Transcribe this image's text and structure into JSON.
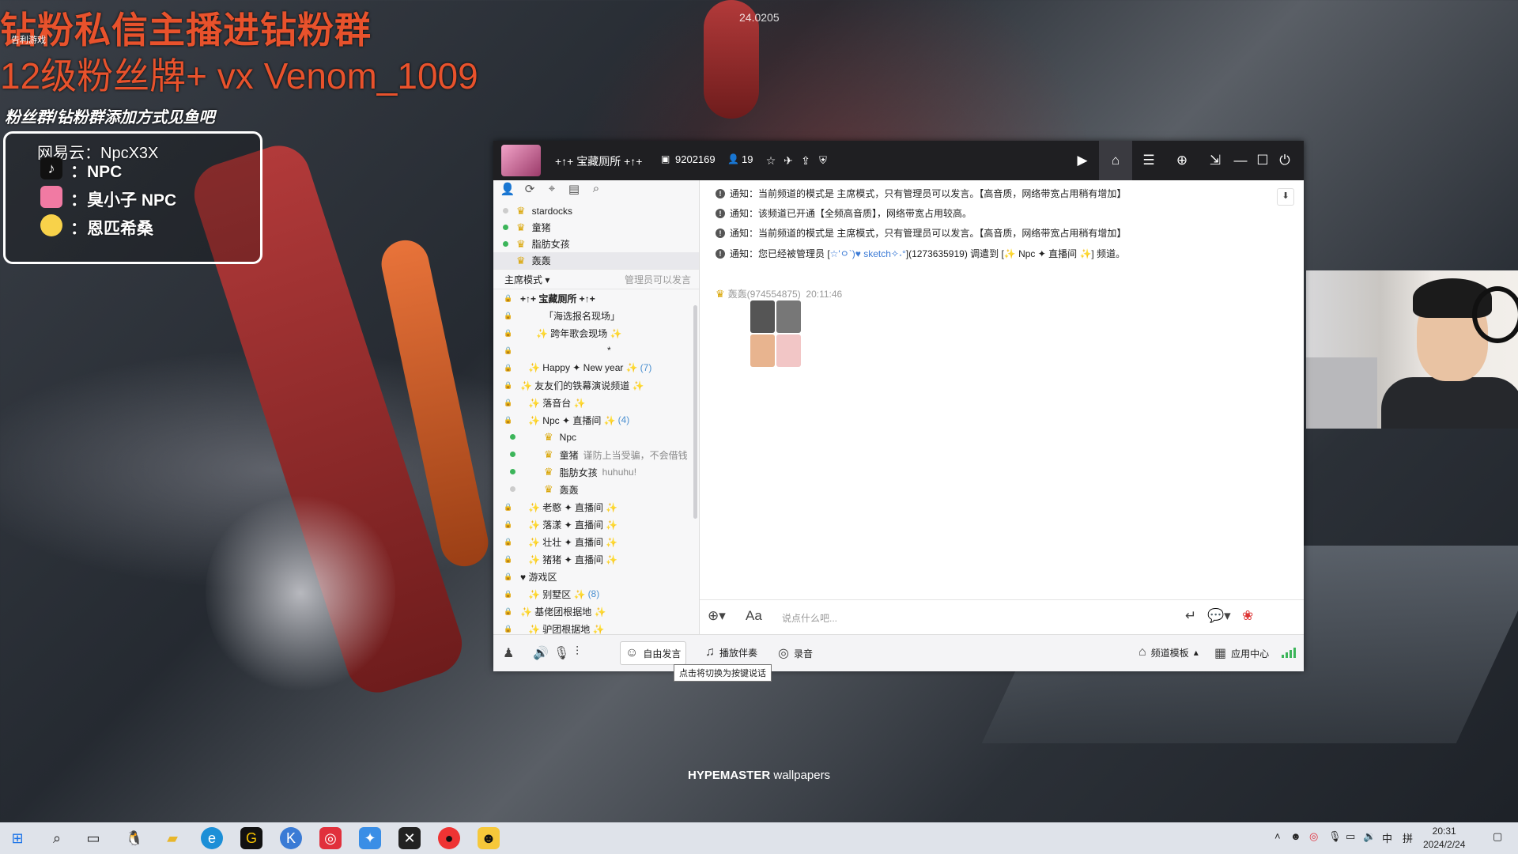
{
  "overlay": {
    "line1": "钻粉私信主播进钻粉群",
    "small": "告利游戏",
    "line2": "12级粉丝牌+ vx Venom_1009",
    "line3": "粉丝群/钻粉群添加方式见鱼吧",
    "netease": "网易云：NpcX3X",
    "tiktok": "：NPC",
    "bilibili": "：臭小子 NPC",
    "weibo": "：恩匹希桑",
    "center_num": "24.0205",
    "hype_bold": "HYPEMASTER",
    "hype_rest": " wallpapers"
  },
  "app": {
    "title_prefix": "+↑+ 宝藏厕所 +↑+",
    "room_id": "9202169",
    "online": "19",
    "members": [
      {
        "name": "stardocks",
        "status": "off"
      },
      {
        "name": "童猪",
        "status": "on"
      },
      {
        "name": "脂肪女孩",
        "status": "on"
      },
      {
        "name": "轰轰",
        "status": "sel"
      }
    ],
    "mode_label": "主席模式",
    "mode_note": "管理员可以发言",
    "channels": [
      {
        "text": "+↑+ 宝藏厕所 +↑+",
        "count": "",
        "indent": 0,
        "bold": true
      },
      {
        "text": "「海选报名现场」",
        "count": "",
        "indent": 30
      },
      {
        "text": "✨ 跨年歌会现场 ✨",
        "count": "",
        "indent": 20
      },
      {
        "text": "*",
        "count": "",
        "indent": 110
      },
      {
        "text": "✨ Happy ✦ New year ✨",
        "count": "(7)",
        "indent": 10
      },
      {
        "text": "✨ 友友们的铁幕演说频道 ✨",
        "count": "",
        "indent": 0
      },
      {
        "text": "✨   落音台   ✨",
        "count": "",
        "indent": 10
      },
      {
        "text": "✨  Npc ✦ 直播间  ✨",
        "count": "(4)",
        "indent": 10,
        "active": true
      },
      {
        "text": "Npc",
        "count": "",
        "indent": 30,
        "user": true,
        "note": ""
      },
      {
        "text": "童猪",
        "count": "",
        "indent": 30,
        "user": true,
        "note": "谨防上当受骗，不会借钱"
      },
      {
        "text": "脂肪女孩",
        "count": "",
        "indent": 30,
        "user": true,
        "note": "huhuhu!"
      },
      {
        "text": "轰轰",
        "count": "",
        "indent": 30,
        "user": true,
        "note": ""
      },
      {
        "text": "✨  老憨 ✦ 直播间  ✨",
        "count": "",
        "indent": 10
      },
      {
        "text": "✨  落漾 ✦ 直播间  ✨",
        "count": "",
        "indent": 10
      },
      {
        "text": "✨  壮壮 ✦ 直播间  ✨",
        "count": "",
        "indent": 10
      },
      {
        "text": "✨  猪猪 ✦ 直播间  ✨",
        "count": "",
        "indent": 10
      },
      {
        "text": "♥   游戏区",
        "count": "",
        "indent": 0
      },
      {
        "text": "✨    别墅区    ✨",
        "count": "(8)",
        "indent": 10
      },
      {
        "text": "✨ 基佬团根据地 ✨",
        "count": "",
        "indent": 0
      },
      {
        "text": "✨ 驴团根据地 ✨",
        "count": "",
        "indent": 10
      }
    ],
    "notices": [
      "通知：当前频道的模式是 主席模式，只有管理员可以发言。【高音质，网络带宽占用稍有增加】",
      "通知：该频道已开通【全频高音质】，网络带宽占用较高。",
      "通知：当前频道的模式是 主席模式，只有管理员可以发言。【高音质，网络带宽占用稍有增加】"
    ],
    "notice4_a": "通知：您已经被管理员 [",
    "notice4_b": "☆'ㅇ`)♥ sketch✧˖°",
    "notice4_c": "](1273635919) 调遣到 [✨ Npc ✦ 直播间 ✨] 频道。",
    "msg_author": "轰轰(974554875)",
    "msg_time": "20:11:46",
    "input_placeholder": "说点什么吧...",
    "bottom": {
      "free_speak": "自由发言",
      "play_music": "播放伴奏",
      "record": "录音",
      "template": "频道模板",
      "app_center": "应用中心"
    },
    "tooltip": "点击将切换为按键说话"
  },
  "taskbar": {
    "time": "20:31",
    "date": "2024/2/24",
    "ime": "中",
    "ime2": "拼"
  }
}
